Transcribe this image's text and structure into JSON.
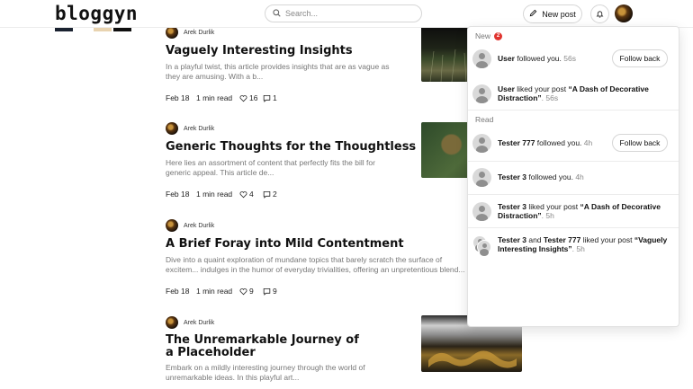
{
  "header": {
    "logo": "bloggyn",
    "search_placeholder": "Search...",
    "new_post_label": "New post"
  },
  "articles": [
    {
      "author": "Arek Durlik",
      "title": "Vaguely Interesting Insights",
      "excerpt": "In a playful twist, this article provides insights that are as vague as they are amusing. With a b...",
      "date": "Feb 18",
      "read_time": "1 min read",
      "likes": "16",
      "comments": "1"
    },
    {
      "author": "Arek Durlik",
      "title": "Generic Thoughts for the Thoughtless",
      "excerpt": "Here lies an assortment of content that perfectly fits the bill for generic appeal. This article de...",
      "date": "Feb 18",
      "read_time": "1 min read",
      "likes": "4",
      "comments": "2"
    },
    {
      "author": "Arek Durlik",
      "title": "A Brief Foray into Mild Contentment",
      "excerpt": "Dive into a quaint exploration of mundane topics that barely scratch the surface of excitem... indulges in the humor of everyday trivialities, offering an unpretentious blend...",
      "date": "Feb 18",
      "read_time": "1 min read",
      "likes": "9",
      "comments": "9"
    },
    {
      "author": "Arek Durlik",
      "title_line1": "The Unremarkable Journey of",
      "title_line2": "a Placeholder",
      "excerpt": "Embark on a mildly interesting journey through the world of unremarkable ideas. In this playful art..."
    }
  ],
  "notifications": {
    "new_label": "New",
    "new_count": "2",
    "read_label": "Read",
    "follow_back_label": "Follow back",
    "items": [
      {
        "user": "User",
        "text": " followed you.",
        "time": " 56s"
      },
      {
        "user": "User",
        "text": " liked your post ",
        "post": "“A Dash of Decorative Distraction”",
        "time": ". 56s"
      },
      {
        "user": "Tester 777",
        "text": " followed you.",
        "time": " 4h"
      },
      {
        "user": "Tester 3",
        "text": " followed you.",
        "time": " 4h"
      },
      {
        "user": "Tester 3",
        "text": " liked your post ",
        "post": "“A Dash of Decorative Distraction”",
        "time": ". 5h"
      },
      {
        "user": "Tester 3",
        "and": " and ",
        "user2": "Tester 777",
        "text": " liked your post ",
        "post": "“Vaguely Interesting Insights”",
        "time": ". 5h"
      }
    ]
  },
  "colors": {
    "badge": "#e0342f",
    "text": "#111111",
    "muted": "#777777"
  }
}
